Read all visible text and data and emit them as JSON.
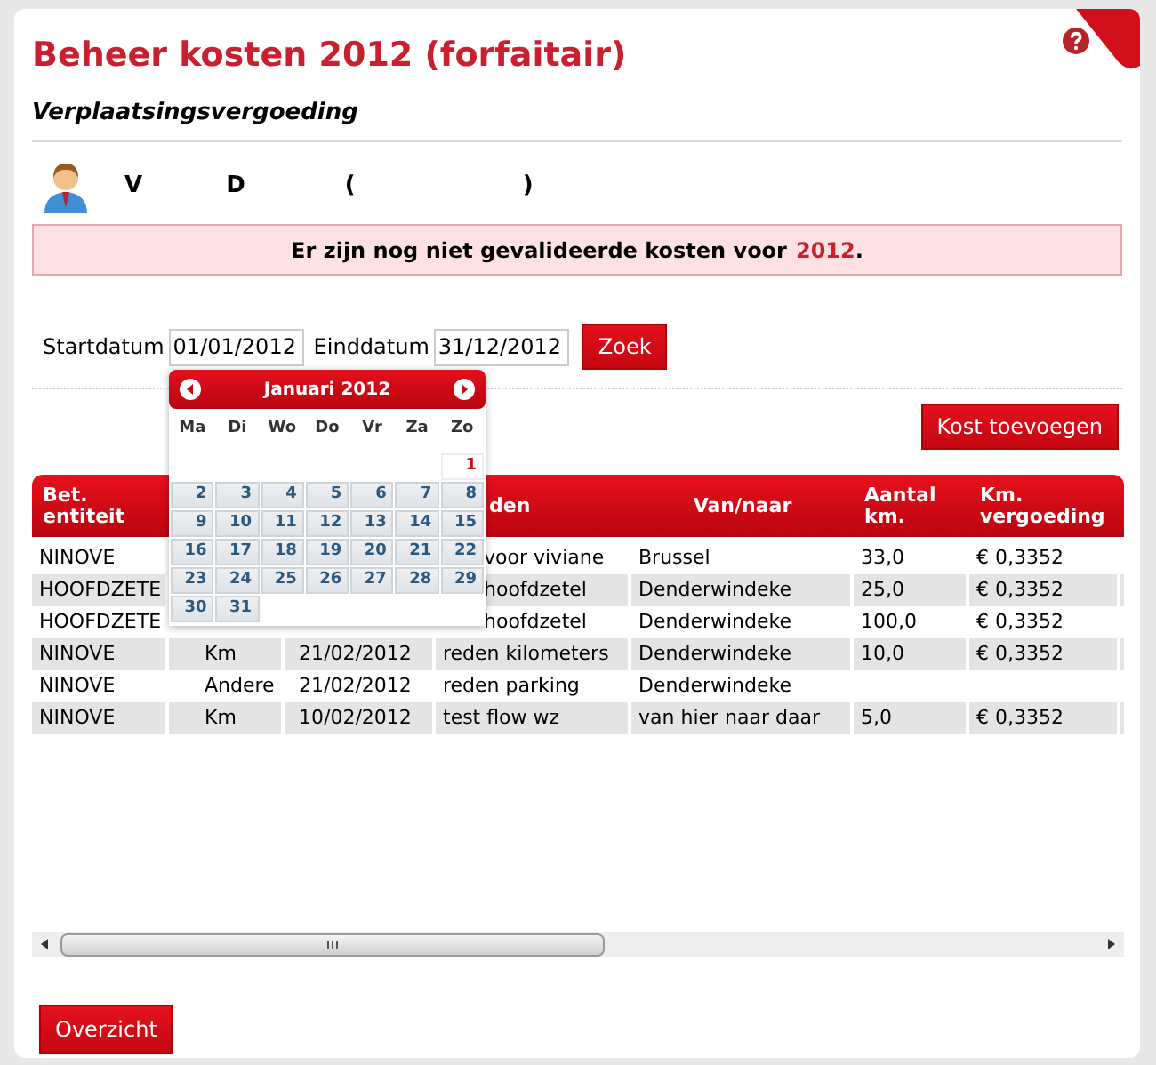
{
  "title": "Beheer kosten 2012 (forfaitair)",
  "subtitle": "Verplaatsingsvergoeding",
  "user": {
    "parts": [
      "V",
      "D",
      "(",
      ")"
    ]
  },
  "alert": {
    "text": "Er zijn nog niet gevalideerde kosten voor",
    "year": "2012",
    "end": "."
  },
  "filter": {
    "start_label": "Startdatum",
    "start_value": "01/01/2012",
    "end_label": "Einddatum",
    "end_value": "31/12/2012",
    "search_button": "Zoek"
  },
  "calendar": {
    "month": "Januari 2012",
    "weekdays": [
      "Ma",
      "Di",
      "Wo",
      "Do",
      "Vr",
      "Za",
      "Zo"
    ],
    "weeks": [
      [
        {
          "kind": "empty"
        },
        {
          "kind": "empty"
        },
        {
          "kind": "empty"
        },
        {
          "kind": "empty"
        },
        {
          "kind": "empty"
        },
        {
          "kind": "empty"
        },
        {
          "kind": "day",
          "day": "1",
          "selected": true
        }
      ],
      [
        {
          "kind": "day",
          "day": "2",
          "selected": false
        },
        {
          "kind": "day",
          "day": "3",
          "selected": false
        },
        {
          "kind": "day",
          "day": "4",
          "selected": false
        },
        {
          "kind": "day",
          "day": "5",
          "selected": false
        },
        {
          "kind": "day",
          "day": "6",
          "selected": false
        },
        {
          "kind": "day",
          "day": "7",
          "selected": false
        },
        {
          "kind": "day",
          "day": "8",
          "selected": false
        }
      ],
      [
        {
          "kind": "day",
          "day": "9",
          "selected": false
        },
        {
          "kind": "day",
          "day": "10",
          "selected": false
        },
        {
          "kind": "day",
          "day": "11",
          "selected": false
        },
        {
          "kind": "day",
          "day": "12",
          "selected": false
        },
        {
          "kind": "day",
          "day": "13",
          "selected": false
        },
        {
          "kind": "day",
          "day": "14",
          "selected": false
        },
        {
          "kind": "day",
          "day": "15",
          "selected": false
        }
      ],
      [
        {
          "kind": "day",
          "day": "16",
          "selected": false
        },
        {
          "kind": "day",
          "day": "17",
          "selected": false
        },
        {
          "kind": "day",
          "day": "18",
          "selected": false
        },
        {
          "kind": "day",
          "day": "19",
          "selected": false
        },
        {
          "kind": "day",
          "day": "20",
          "selected": false
        },
        {
          "kind": "day",
          "day": "21",
          "selected": false
        },
        {
          "kind": "day",
          "day": "22",
          "selected": false
        }
      ],
      [
        {
          "kind": "day",
          "day": "23",
          "selected": false
        },
        {
          "kind": "day",
          "day": "24",
          "selected": false
        },
        {
          "kind": "day",
          "day": "25",
          "selected": false
        },
        {
          "kind": "day",
          "day": "26",
          "selected": false
        },
        {
          "kind": "day",
          "day": "27",
          "selected": false
        },
        {
          "kind": "day",
          "day": "28",
          "selected": false
        },
        {
          "kind": "day",
          "day": "29",
          "selected": false
        }
      ],
      [
        {
          "kind": "day",
          "day": "30",
          "selected": false
        },
        {
          "kind": "day",
          "day": "31",
          "selected": false
        },
        {
          "kind": "empty"
        },
        {
          "kind": "empty"
        },
        {
          "kind": "empty"
        },
        {
          "kind": "empty"
        },
        {
          "kind": "empty"
        }
      ]
    ]
  },
  "add_button": "Kost toevoegen",
  "table": {
    "columns": [
      {
        "label": "Bet. entiteit"
      },
      {},
      {},
      {
        "label": "den"
      },
      {
        "label": "Van/naar"
      },
      {
        "label": "Aantal km."
      },
      {
        "label": "Km. vergoeding"
      }
    ],
    "rows": [
      {
        "cells": [
          "NINOVE",
          null,
          null,
          "voor viviane",
          "Brussel",
          "33,0",
          "€ 0,3352"
        ]
      },
      {
        "cells": [
          "HOOFDZETE",
          null,
          null,
          "hoofdzetel",
          "Denderwindeke",
          "25,0",
          "€ 0,3352"
        ]
      },
      {
        "cells": [
          "HOOFDZETE",
          null,
          null,
          "hoofdzetel",
          "Denderwindeke",
          "100,0",
          "€ 0,3352"
        ]
      },
      {
        "cells": [
          "NINOVE",
          "Km",
          "21/02/2012",
          "reden kilometers",
          "Denderwindeke",
          "10,0",
          "€ 0,3352"
        ]
      },
      {
        "cells": [
          "NINOVE",
          "Andere",
          "21/02/2012",
          "reden parking",
          "Denderwindeke",
          null,
          null
        ]
      },
      {
        "cells": [
          "NINOVE",
          "Km",
          "10/02/2012",
          "test flow wz",
          "van hier naar daar",
          "5,0",
          "€ 0,3352"
        ]
      }
    ]
  },
  "overview_button": "Overzicht"
}
